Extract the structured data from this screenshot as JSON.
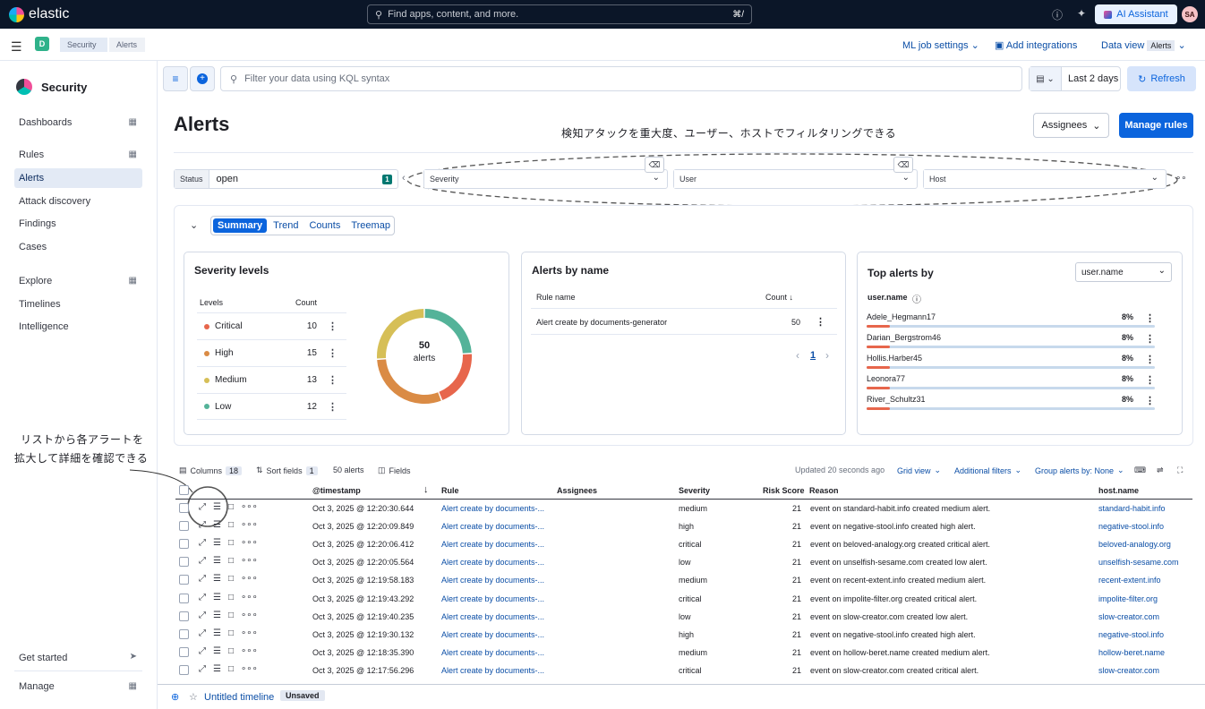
{
  "topbar": {
    "brand": "elastic",
    "search_placeholder": "Find apps, content, and more.",
    "search_shortcut": "⌘/",
    "ai_assistant": "AI Assistant",
    "avatar_initials": "SA"
  },
  "subbar": {
    "space_initial": "D",
    "breadcrumb": [
      "Security",
      "Alerts"
    ],
    "ml_job_settings": "ML job settings",
    "add_integrations": "Add integrations",
    "data_view_label": "Data view",
    "data_view_value": "Alerts"
  },
  "sidebar": {
    "title": "Security",
    "items": [
      {
        "label": "Dashboards",
        "grid": true
      },
      {
        "label": "Rules",
        "grid": true
      },
      {
        "label": "Alerts",
        "grid": false,
        "active": true
      },
      {
        "label": "Attack discovery",
        "grid": false
      },
      {
        "label": "Findings",
        "grid": false
      },
      {
        "label": "Cases",
        "grid": false
      },
      {
        "label": "Explore",
        "grid": true
      },
      {
        "label": "Timelines",
        "grid": false
      },
      {
        "label": "Intelligence",
        "grid": false
      }
    ],
    "get_started": "Get started",
    "manage": "Manage"
  },
  "toolbar": {
    "kql_placeholder": "Filter your data using KQL syntax",
    "date_range": "Last 2 days",
    "refresh": "Refresh"
  },
  "page": {
    "title": "Alerts",
    "assignees": "Assignees",
    "manage_rules": "Manage rules"
  },
  "annotations": {
    "filter_note": "検知アタックを重大度、ユーザー、ホストでフィルタリングできる",
    "expand_note_line1": "リストから各アラートを",
    "expand_note_line2": "拡大して詳細を確認できる"
  },
  "filters": {
    "status_label": "Status",
    "status_value": "open",
    "status_count": "1",
    "severity_label": "Severity",
    "user_label": "User",
    "host_label": "Host"
  },
  "summary": {
    "tabs": [
      "Summary",
      "Trend",
      "Counts",
      "Treemap"
    ],
    "severity": {
      "title": "Severity levels",
      "col_levels": "Levels",
      "col_count": "Count",
      "rows": [
        {
          "label": "Critical",
          "count": 10,
          "color": "#e7664c"
        },
        {
          "label": "High",
          "count": 15,
          "color": "#da8b45"
        },
        {
          "label": "Medium",
          "count": 13,
          "color": "#d6bf57"
        },
        {
          "label": "Low",
          "count": 12,
          "color": "#54b399"
        }
      ],
      "donut_total": "50",
      "donut_label": "alerts"
    },
    "by_name": {
      "title": "Alerts by name",
      "col_rule": "Rule name",
      "col_count": "Count",
      "rows": [
        {
          "rule": "Alert create by documents-generator",
          "count": "50"
        }
      ],
      "page": "1"
    },
    "top": {
      "title": "Top alerts by",
      "select_value": "user.name",
      "field_label": "user.name",
      "rows": [
        {
          "user": "Adele_Hegmann17",
          "pct": "8%",
          "value": 8
        },
        {
          "user": "Darian_Bergstrom46",
          "pct": "8%",
          "value": 8
        },
        {
          "user": "Hollis.Harber45",
          "pct": "8%",
          "value": 8
        },
        {
          "user": "Leonora77",
          "pct": "8%",
          "value": 8
        },
        {
          "user": "River_Schultz31",
          "pct": "8%",
          "value": 8
        }
      ]
    }
  },
  "grid": {
    "columns_label": "Columns",
    "columns_count": "18",
    "sort_label": "Sort fields",
    "sort_count": "1",
    "alerts_count": "50 alerts",
    "fields_label": "Fields",
    "updated": "Updated 20 seconds ago",
    "grid_view": "Grid view",
    "additional_filters": "Additional filters",
    "group_by": "Group alerts by: None",
    "headers": {
      "timestamp": "@timestamp",
      "rule": "Rule",
      "assignees": "Assignees",
      "severity": "Severity",
      "risk": "Risk Score",
      "reason": "Reason",
      "host": "host.name"
    },
    "rows": [
      {
        "timestamp": "Oct 3, 2025 @ 12:20:30.644",
        "rule": "Alert create by documents-...",
        "severity": "medium",
        "risk": "21",
        "reason": "event on standard-habit.info created medium alert.",
        "host": "standard-habit.info"
      },
      {
        "timestamp": "Oct 3, 2025 @ 12:20:09.849",
        "rule": "Alert create by documents-...",
        "severity": "high",
        "risk": "21",
        "reason": "event on negative-stool.info created high alert.",
        "host": "negative-stool.info"
      },
      {
        "timestamp": "Oct 3, 2025 @ 12:20:06.412",
        "rule": "Alert create by documents-...",
        "severity": "critical",
        "risk": "21",
        "reason": "event on beloved-analogy.org created critical alert.",
        "host": "beloved-analogy.org"
      },
      {
        "timestamp": "Oct 3, 2025 @ 12:20:05.564",
        "rule": "Alert create by documents-...",
        "severity": "low",
        "risk": "21",
        "reason": "event on unselfish-sesame.com created low alert.",
        "host": "unselfish-sesame.com"
      },
      {
        "timestamp": "Oct 3, 2025 @ 12:19:58.183",
        "rule": "Alert create by documents-...",
        "severity": "medium",
        "risk": "21",
        "reason": "event on recent-extent.info created medium alert.",
        "host": "recent-extent.info"
      },
      {
        "timestamp": "Oct 3, 2025 @ 12:19:43.292",
        "rule": "Alert create by documents-...",
        "severity": "critical",
        "risk": "21",
        "reason": "event on impolite-filter.org created critical alert.",
        "host": "impolite-filter.org"
      },
      {
        "timestamp": "Oct 3, 2025 @ 12:19:40.235",
        "rule": "Alert create by documents-...",
        "severity": "low",
        "risk": "21",
        "reason": "event on slow-creator.com created low alert.",
        "host": "slow-creator.com"
      },
      {
        "timestamp": "Oct 3, 2025 @ 12:19:30.132",
        "rule": "Alert create by documents-...",
        "severity": "high",
        "risk": "21",
        "reason": "event on negative-stool.info created high alert.",
        "host": "negative-stool.info"
      },
      {
        "timestamp": "Oct 3, 2025 @ 12:18:35.390",
        "rule": "Alert create by documents-...",
        "severity": "medium",
        "risk": "21",
        "reason": "event on hollow-beret.name created medium alert.",
        "host": "hollow-beret.name"
      },
      {
        "timestamp": "Oct 3, 2025 @ 12:17:56.296",
        "rule": "Alert create by documents-...",
        "severity": "critical",
        "risk": "21",
        "reason": "event on slow-creator.com created critical alert.",
        "host": "slow-creator.com"
      }
    ]
  },
  "timeline": {
    "title": "Untitled timeline",
    "status": "Unsaved"
  }
}
